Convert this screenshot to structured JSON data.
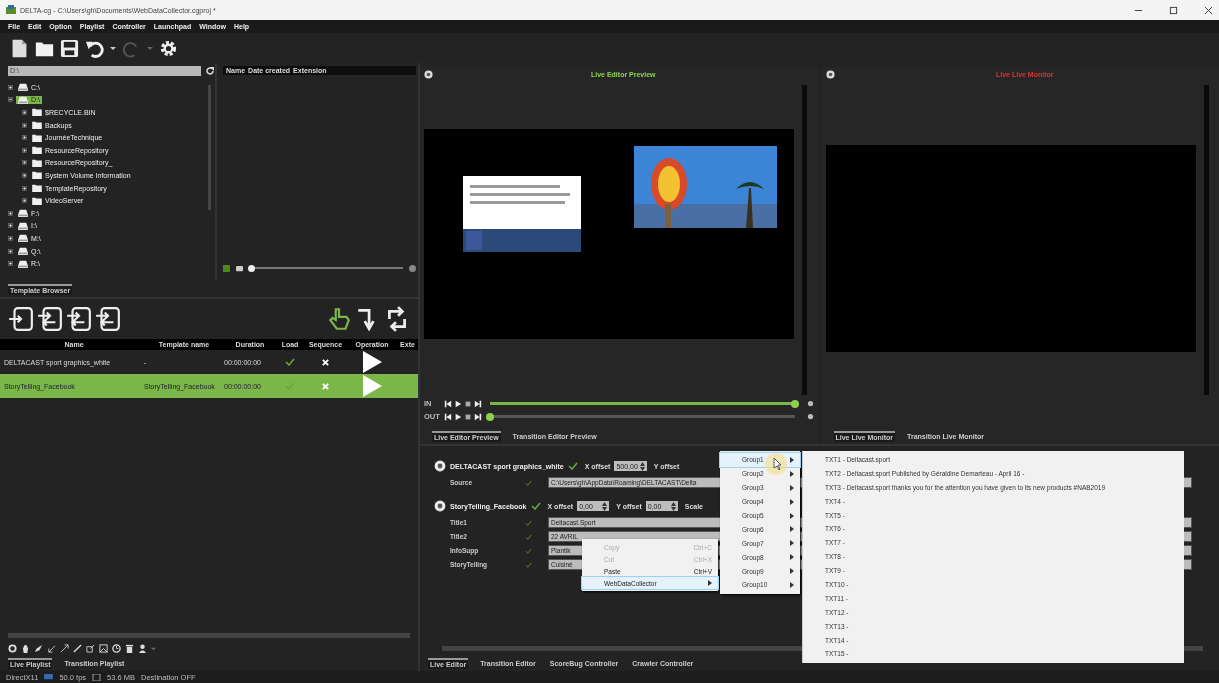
{
  "window": {
    "title": "DELTA-cg - C:\\Users\\gh\\Documents\\WebDataCollector.cgproj *"
  },
  "menu": [
    "File",
    "Edit",
    "Option",
    "Playlist",
    "Controller",
    "Launchpad",
    "Window",
    "Help"
  ],
  "browser": {
    "path": "D:\\",
    "columns": [
      "Name",
      "Date created",
      "Extension"
    ],
    "tree": [
      {
        "label": "C:\\",
        "kind": "drive",
        "expanded": false,
        "selected": false
      },
      {
        "label": "D:\\",
        "kind": "drive",
        "expanded": true,
        "selected": true,
        "children": [
          {
            "label": "$RECYCLE.BIN",
            "kind": "folder",
            "expanded": false,
            "selected": false
          },
          {
            "label": "Backups",
            "kind": "folder",
            "expanded": false,
            "selected": false
          },
          {
            "label": "JournéeTechnique",
            "kind": "folder",
            "expanded": false,
            "selected": false
          },
          {
            "label": "ResourceRepository",
            "kind": "folder",
            "expanded": false,
            "selected": false
          },
          {
            "label": "ResourceRepository_",
            "kind": "folder",
            "expanded": false,
            "selected": false
          },
          {
            "label": "System Volume Information",
            "kind": "folder",
            "expanded": false,
            "selected": false
          },
          {
            "label": "TemplateRepository",
            "kind": "folder",
            "expanded": false,
            "selected": false
          },
          {
            "label": "VideoServer",
            "kind": "folder",
            "expanded": false,
            "selected": false
          }
        ]
      },
      {
        "label": "F:\\",
        "kind": "drive",
        "expanded": false,
        "selected": false
      },
      {
        "label": "I:\\",
        "kind": "drive",
        "expanded": false,
        "selected": false
      },
      {
        "label": "M:\\",
        "kind": "drive",
        "expanded": false,
        "selected": false
      },
      {
        "label": "Q:\\",
        "kind": "drive",
        "expanded": false,
        "selected": false
      },
      {
        "label": "R:\\",
        "kind": "drive",
        "expanded": false,
        "selected": false
      }
    ],
    "zoom": {
      "level": 0.0
    },
    "tabs": [
      {
        "label": "Template Browser",
        "selected": true
      }
    ]
  },
  "playlist": {
    "columns": [
      "Name",
      "Template name",
      "Duration",
      "Load",
      "Sequence",
      "Operation",
      "Exte"
    ],
    "rows": [
      {
        "name": "DELTACAST sport graphics_white",
        "template": "-",
        "duration": "00:00:00:00",
        "loaded": true,
        "selected": false
      },
      {
        "name": "StoryTelling_Facebook",
        "template": "StoryTelling_Facebook",
        "duration": "00:00:00:00",
        "loaded": true,
        "selected": true
      }
    ],
    "tabs": [
      {
        "label": "Live Playlist",
        "selected": true
      },
      {
        "label": "Transition Playlist",
        "selected": false
      }
    ]
  },
  "preview": {
    "title": "Live Editor Preview",
    "transport": [
      {
        "label": "IN",
        "level": 1.0
      },
      {
        "label": "OUT",
        "level": 0.0
      }
    ],
    "tabs": [
      {
        "label": "Live Editor Preview",
        "selected": true
      },
      {
        "label": "Transition Editor Preview",
        "selected": false
      }
    ]
  },
  "monitor": {
    "title": "Live Live Monitor",
    "tabs": [
      {
        "label": "Live Live Monitor",
        "selected": true
      },
      {
        "label": "Transition Live Monitor",
        "selected": false
      }
    ]
  },
  "editor": {
    "items": [
      {
        "name": "DELTACAST sport graphics_white",
        "loaded": true,
        "params": [
          {
            "label": "X offset",
            "value": "500,00"
          },
          {
            "label": "Y offset"
          }
        ],
        "fields": [
          {
            "label": "Source",
            "value": "C:\\Users\\gh\\AppData\\Roaming\\DELTACAST\\Delta"
          }
        ]
      },
      {
        "name": "StoryTelling_Facebook",
        "loaded": true,
        "params": [
          {
            "label": "X offset",
            "value": "0,00"
          },
          {
            "label": "Y offset",
            "value": "0,00"
          },
          {
            "label": "Scale"
          }
        ],
        "fields": [
          {
            "label": "Title1",
            "value": "Deltacast.Sport"
          },
          {
            "label": "Title2",
            "value": "22 AVRIL"
          },
          {
            "label": "InfoSupp",
            "value": "Plantik"
          },
          {
            "label": "StoryTelling",
            "value": "Cuisiné"
          }
        ]
      }
    ],
    "tabs": [
      {
        "label": "Live Editor",
        "selected": true
      },
      {
        "label": "Transition Editor",
        "selected": false
      },
      {
        "label": "ScoreBug Controller",
        "selected": false
      },
      {
        "label": "Crawler Controller",
        "selected": false
      }
    ]
  },
  "context_menu": {
    "items": [
      {
        "label": "Copy",
        "shortcut": "Ctrl+C",
        "disabled": true,
        "selected": false
      },
      {
        "label": "Cut",
        "shortcut": "Ctrl+X",
        "disabled": true,
        "selected": false
      },
      {
        "label": "Paste",
        "shortcut": "Ctrl+V",
        "disabled": false,
        "selected": false
      },
      {
        "label": "WebDataCollector",
        "disabled": false,
        "selected": true
      }
    ],
    "groups": [
      {
        "label": "Group1",
        "selected": true
      },
      {
        "label": "Group2",
        "selected": false
      },
      {
        "label": "Group3",
        "selected": false
      },
      {
        "label": "Group4",
        "selected": false
      },
      {
        "label": "Group5",
        "selected": false
      },
      {
        "label": "Group6",
        "selected": false
      },
      {
        "label": "Group7",
        "selected": false
      },
      {
        "label": "Group8",
        "selected": false
      },
      {
        "label": "Group9",
        "selected": false
      },
      {
        "label": "Group10",
        "selected": false
      }
    ],
    "texts": [
      "TXT1 - Deltacast.sport",
      "TXT2 - Deltacast.sport Published by Géraldine Demarteau - April 16 -",
      "TXT3 - Deltacast.sport thanks you for the attention you have given to its new products #NAB2019",
      "TXT4 -",
      "TXT5 -",
      "TXT6 -",
      "TXT7 -",
      "TXT8 -",
      "TXT9 -",
      "TXT10 -",
      "TXT11 -",
      "TXT12 -",
      "TXT13 -",
      "TXT14 -",
      "TXT15 -"
    ]
  },
  "status_bar": [
    "DirectX11",
    "50.0 fps",
    "53.6 MB",
    "Destination OFF"
  ]
}
